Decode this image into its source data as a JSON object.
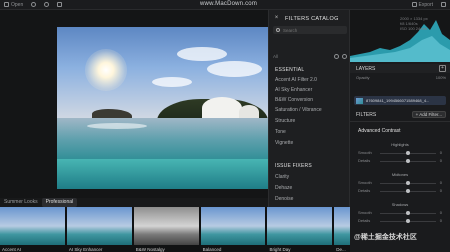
{
  "toolbar": {
    "items": [
      "Open",
      "Undo",
      "Redo",
      "Compare",
      "Export",
      "Share"
    ],
    "watermark": "www.MacDown.com"
  },
  "catalog": {
    "title": "FILTERS CATALOG",
    "search_placeholder": "Search",
    "favorites_label": "All",
    "sections": [
      {
        "title": "ESSENTIAL",
        "items": [
          "Accent AI Filter 2.0",
          "AI Sky Enhancer",
          "B&W Conversion",
          "Saturation / Vibrance",
          "Structure",
          "Tone",
          "Vignette"
        ]
      },
      {
        "title": "ISSUE FIXERS",
        "items": [
          "Clarity",
          "Dehaze",
          "Denoise"
        ]
      }
    ]
  },
  "histogram": {
    "info_lines": [
      "2000 × 1334 px",
      "f/8  1/640s",
      "ISO 100  24mm"
    ]
  },
  "layers": {
    "title": "LAYERS",
    "opacity_label": "Opacity",
    "opacity_value": "100%",
    "layer_name": "87609841_1994566071589468_4..."
  },
  "filters": {
    "title": "FILTERS",
    "add_label": "+ Add Filter...",
    "group_title": "Advanced Contrast",
    "subgroups": [
      {
        "label": "Highlights",
        "sliders": [
          {
            "name": "Smooth",
            "value": "0",
            "level": 0.5
          },
          {
            "name": "Details",
            "value": "0",
            "level": 0.5
          }
        ]
      },
      {
        "label": "Midtones",
        "sliders": [
          {
            "name": "Smooth",
            "value": "0",
            "level": 0.5
          },
          {
            "name": "Details",
            "value": "0",
            "level": 0.5
          }
        ]
      },
      {
        "label": "Shadows",
        "sliders": [
          {
            "name": "Smooth",
            "value": "0",
            "level": 0.5
          },
          {
            "name": "Details",
            "value": "0",
            "level": 0.5
          }
        ]
      }
    ],
    "bottom_watermark": "@稀土掘金技术社区"
  },
  "looks": {
    "tabs": [
      "Summer Looks",
      "Professional"
    ],
    "active_tab": 1,
    "thumbs": [
      {
        "label": "Accent AI",
        "style": "color"
      },
      {
        "label": "AI Sky Enhancer",
        "style": "color"
      },
      {
        "label": "B&W Nostalgy",
        "style": "gray"
      },
      {
        "label": "Balanced",
        "style": "color"
      },
      {
        "label": "Bright Day",
        "style": "color"
      },
      {
        "label": "De...",
        "style": "color"
      }
    ]
  }
}
